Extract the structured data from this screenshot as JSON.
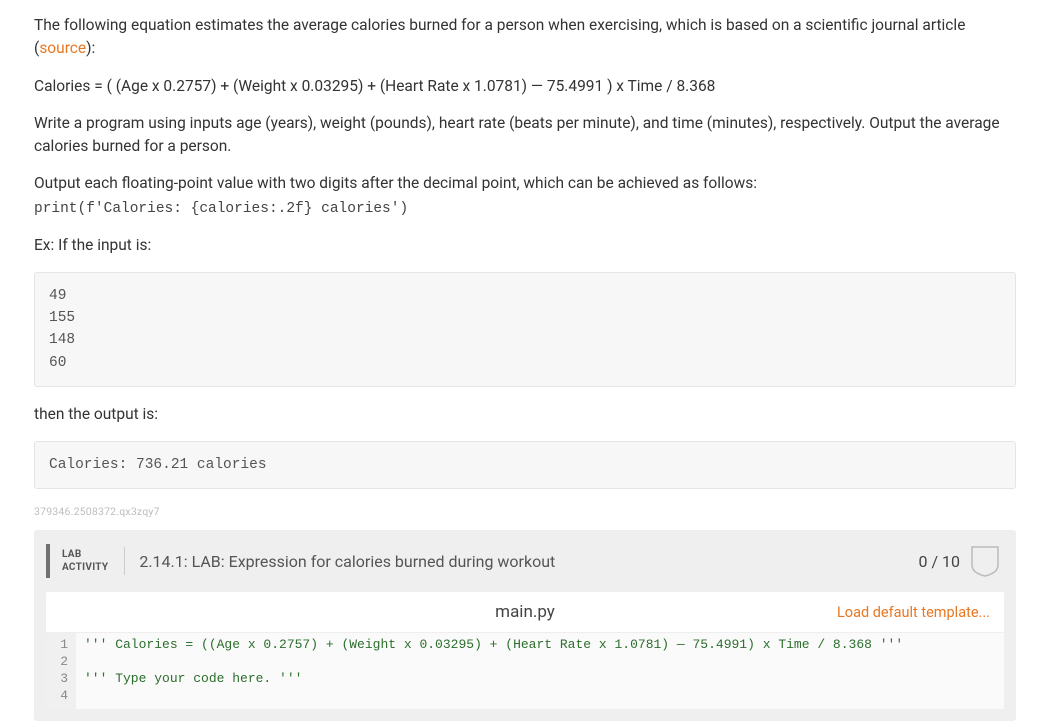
{
  "intro": {
    "p1_pre": "The following equation estimates the average calories burned for a person when exercising, which is based on a scientific journal article (",
    "source_label": "source",
    "p1_post": "):",
    "formula": "Calories = ( (Age x 0.2757) + (Weight x 0.03295) + (Heart Rate x 1.0781) — 75.4991 ) x Time / 8.368",
    "p2": "Write a program using inputs age (years), weight (pounds), heart rate (beats per minute), and time (minutes), respectively. Output the average calories burned for a person.",
    "p3": "Output each floating-point value with two digits after the decimal point, which can be achieved as follows:",
    "print_example": "print(f'Calories: {calories:.2f} calories')",
    "example_intro": "Ex: If the input is:",
    "example_input": "49\n155\n148\n60",
    "example_out_intro": "then the output is:",
    "example_output": "Calories: 736.21 calories"
  },
  "qid": "379346.2508372.qx3zqy7",
  "lab": {
    "badge_line1": "LAB",
    "badge_line2": "ACTIVITY",
    "title": "2.14.1: LAB: Expression for calories burned during workout",
    "score": "0 / 10"
  },
  "editor": {
    "filename": "main.py",
    "load_template": "Load default template...",
    "lines": [
      "''' Calories = ((Age x 0.2757) + (Weight x 0.03295) + (Heart Rate x 1.0781) — 75.4991) x Time / 8.368 '''",
      "",
      "''' Type your code here. '''",
      ""
    ]
  }
}
